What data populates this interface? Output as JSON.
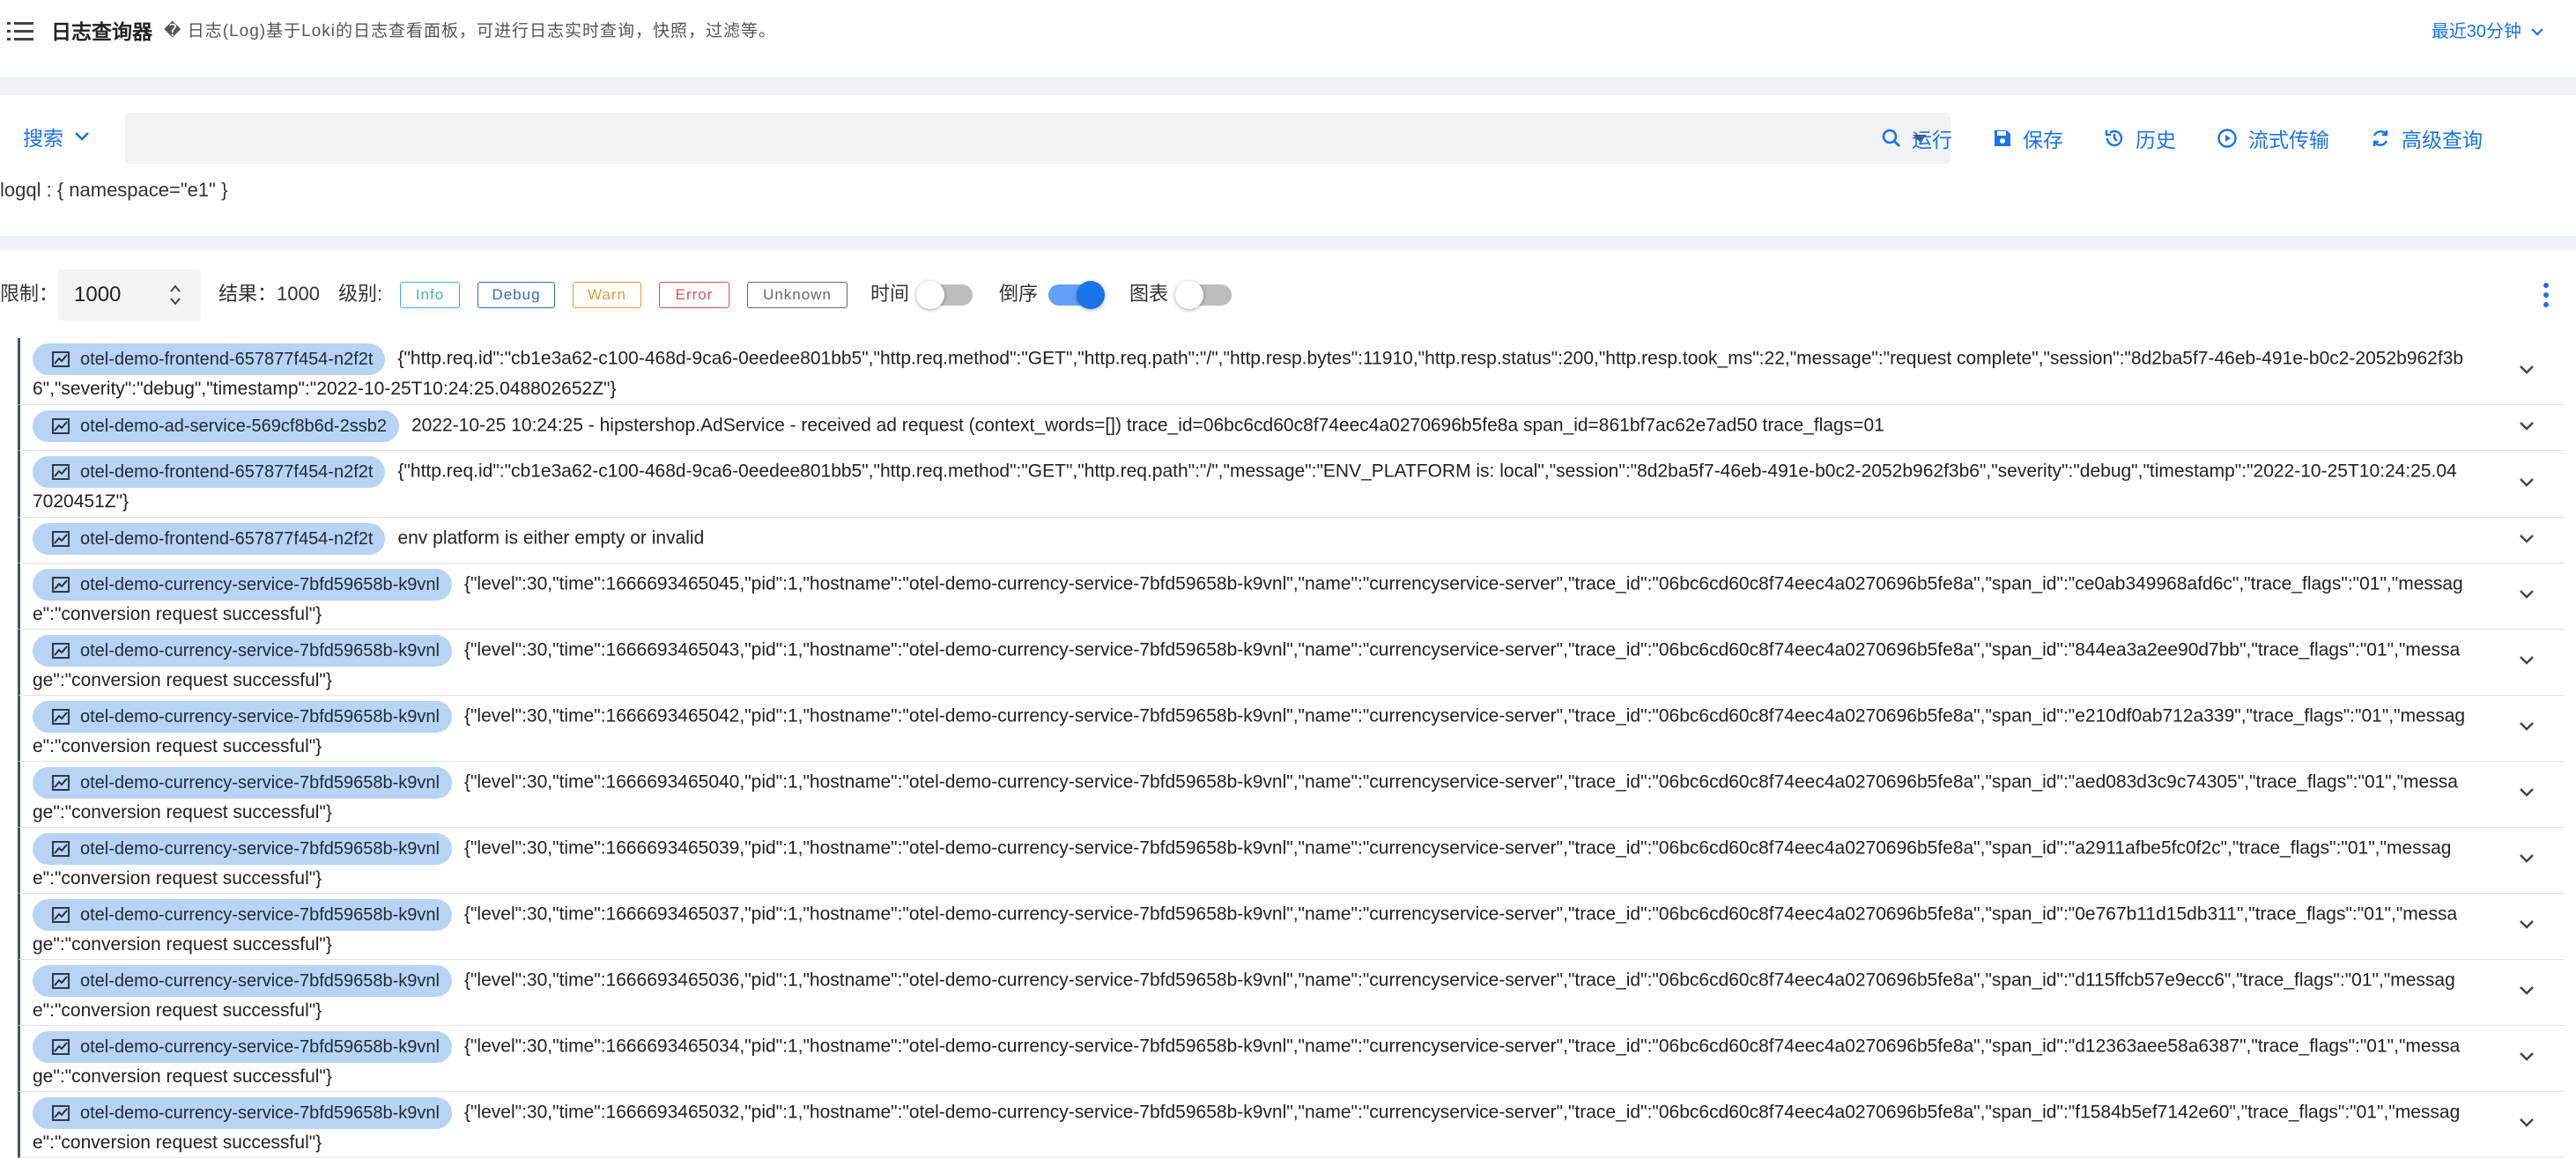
{
  "header": {
    "title": "日志查询器",
    "description": "� 日志(Log)基于Loki的日志查看面板，可进行日志实时查询，快照，过滤等。",
    "time_range": "最近30分钟"
  },
  "search": {
    "mode_label": "搜索",
    "query_value": "",
    "actions": [
      {
        "label": "运行",
        "icon": "search-icon"
      },
      {
        "label": "保存",
        "icon": "save-icon"
      },
      {
        "label": "历史",
        "icon": "history-icon"
      },
      {
        "label": "流式传输",
        "icon": "play-circle-icon"
      },
      {
        "label": "高级查询",
        "icon": "sync-icon"
      }
    ],
    "logql": "logql : { namespace=\"e1\" }"
  },
  "filters": {
    "limit_label": "限制：",
    "limit_value": "1000",
    "result_text": "结果：1000",
    "level_label": "级别:",
    "levels": [
      {
        "label": "Info",
        "color": "#3fb0e0"
      },
      {
        "label": "Debug",
        "color": "#2c6db5"
      },
      {
        "label": "Warn",
        "color": "#e39a3b"
      },
      {
        "label": "Error",
        "color": "#d9534f"
      },
      {
        "label": "Unknown",
        "color": "#666666"
      }
    ],
    "time_label": "时间",
    "time_on": false,
    "reverse_label": "倒序",
    "reverse_on": true,
    "chart_label": "图表",
    "chart_on": false
  },
  "logs": [
    {
      "pod": "otel-demo-frontend-657877f454-n2f2t",
      "message": "{\"http.req.id\":\"cb1e3a62-c100-468d-9ca6-0eedee801bb5\",\"http.req.method\":\"GET\",\"http.req.path\":\"/\",\"http.resp.bytes\":11910,\"http.resp.status\":200,\"http.resp.took_ms\":22,\"message\":\"request complete\",\"session\":\"8d2ba5f7-46eb-491e-b0c2-2052b962f3b6\",\"severity\":\"debug\",\"timestamp\":\"2022-10-25T10:24:25.048802652Z\"}"
    },
    {
      "pod": "otel-demo-ad-service-569cf8b6d-2ssb2",
      "message": "2022-10-25 10:24:25 - hipstershop.AdService - received ad request (context_words=[]) trace_id=06bc6cd60c8f74eec4a0270696b5fe8a span_id=861bf7ac62e7ad50 trace_flags=01"
    },
    {
      "pod": "otel-demo-frontend-657877f454-n2f2t",
      "message": "{\"http.req.id\":\"cb1e3a62-c100-468d-9ca6-0eedee801bb5\",\"http.req.method\":\"GET\",\"http.req.path\":\"/\",\"message\":\"ENV_PLATFORM is: local\",\"session\":\"8d2ba5f7-46eb-491e-b0c2-2052b962f3b6\",\"severity\":\"debug\",\"timestamp\":\"2022-10-25T10:24:25.047020451Z\"}"
    },
    {
      "pod": "otel-demo-frontend-657877f454-n2f2t",
      "message": "env platform is either empty or invalid"
    },
    {
      "pod": "otel-demo-currency-service-7bfd59658b-k9vnl",
      "message": "{\"level\":30,\"time\":1666693465045,\"pid\":1,\"hostname\":\"otel-demo-currency-service-7bfd59658b-k9vnl\",\"name\":\"currencyservice-server\",\"trace_id\":\"06bc6cd60c8f74eec4a0270696b5fe8a\",\"span_id\":\"ce0ab349968afd6c\",\"trace_flags\":\"01\",\"message\":\"conversion request successful\"}"
    },
    {
      "pod": "otel-demo-currency-service-7bfd59658b-k9vnl",
      "message": "{\"level\":30,\"time\":1666693465043,\"pid\":1,\"hostname\":\"otel-demo-currency-service-7bfd59658b-k9vnl\",\"name\":\"currencyservice-server\",\"trace_id\":\"06bc6cd60c8f74eec4a0270696b5fe8a\",\"span_id\":\"844ea3a2ee90d7bb\",\"trace_flags\":\"01\",\"message\":\"conversion request successful\"}"
    },
    {
      "pod": "otel-demo-currency-service-7bfd59658b-k9vnl",
      "message": "{\"level\":30,\"time\":1666693465042,\"pid\":1,\"hostname\":\"otel-demo-currency-service-7bfd59658b-k9vnl\",\"name\":\"currencyservice-server\",\"trace_id\":\"06bc6cd60c8f74eec4a0270696b5fe8a\",\"span_id\":\"e210df0ab712a339\",\"trace_flags\":\"01\",\"message\":\"conversion request successful\"}"
    },
    {
      "pod": "otel-demo-currency-service-7bfd59658b-k9vnl",
      "message": "{\"level\":30,\"time\":1666693465040,\"pid\":1,\"hostname\":\"otel-demo-currency-service-7bfd59658b-k9vnl\",\"name\":\"currencyservice-server\",\"trace_id\":\"06bc6cd60c8f74eec4a0270696b5fe8a\",\"span_id\":\"aed083d3c9c74305\",\"trace_flags\":\"01\",\"message\":\"conversion request successful\"}"
    },
    {
      "pod": "otel-demo-currency-service-7bfd59658b-k9vnl",
      "message": "{\"level\":30,\"time\":1666693465039,\"pid\":1,\"hostname\":\"otel-demo-currency-service-7bfd59658b-k9vnl\",\"name\":\"currencyservice-server\",\"trace_id\":\"06bc6cd60c8f74eec4a0270696b5fe8a\",\"span_id\":\"a2911afbe5fc0f2c\",\"trace_flags\":\"01\",\"message\":\"conversion request successful\"}"
    },
    {
      "pod": "otel-demo-currency-service-7bfd59658b-k9vnl",
      "message": "{\"level\":30,\"time\":1666693465037,\"pid\":1,\"hostname\":\"otel-demo-currency-service-7bfd59658b-k9vnl\",\"name\":\"currencyservice-server\",\"trace_id\":\"06bc6cd60c8f74eec4a0270696b5fe8a\",\"span_id\":\"0e767b11d15db311\",\"trace_flags\":\"01\",\"message\":\"conversion request successful\"}"
    },
    {
      "pod": "otel-demo-currency-service-7bfd59658b-k9vnl",
      "message": "{\"level\":30,\"time\":1666693465036,\"pid\":1,\"hostname\":\"otel-demo-currency-service-7bfd59658b-k9vnl\",\"name\":\"currencyservice-server\",\"trace_id\":\"06bc6cd60c8f74eec4a0270696b5fe8a\",\"span_id\":\"d115ffcb57e9ecc6\",\"trace_flags\":\"01\",\"message\":\"conversion request successful\"}"
    },
    {
      "pod": "otel-demo-currency-service-7bfd59658b-k9vnl",
      "message": "{\"level\":30,\"time\":1666693465034,\"pid\":1,\"hostname\":\"otel-demo-currency-service-7bfd59658b-k9vnl\",\"name\":\"currencyservice-server\",\"trace_id\":\"06bc6cd60c8f74eec4a0270696b5fe8a\",\"span_id\":\"d12363aee58a6387\",\"trace_flags\":\"01\",\"message\":\"conversion request successful\"}"
    },
    {
      "pod": "otel-demo-currency-service-7bfd59658b-k9vnl",
      "message": "{\"level\":30,\"time\":1666693465032,\"pid\":1,\"hostname\":\"otel-demo-currency-service-7bfd59658b-k9vnl\",\"name\":\"currencyservice-server\",\"trace_id\":\"06bc6cd60c8f74eec4a0270696b5fe8a\",\"span_id\":\"f1584b5ef7142e60\",\"trace_flags\":\"01\",\"message\":\"conversion request successful\"}"
    }
  ]
}
